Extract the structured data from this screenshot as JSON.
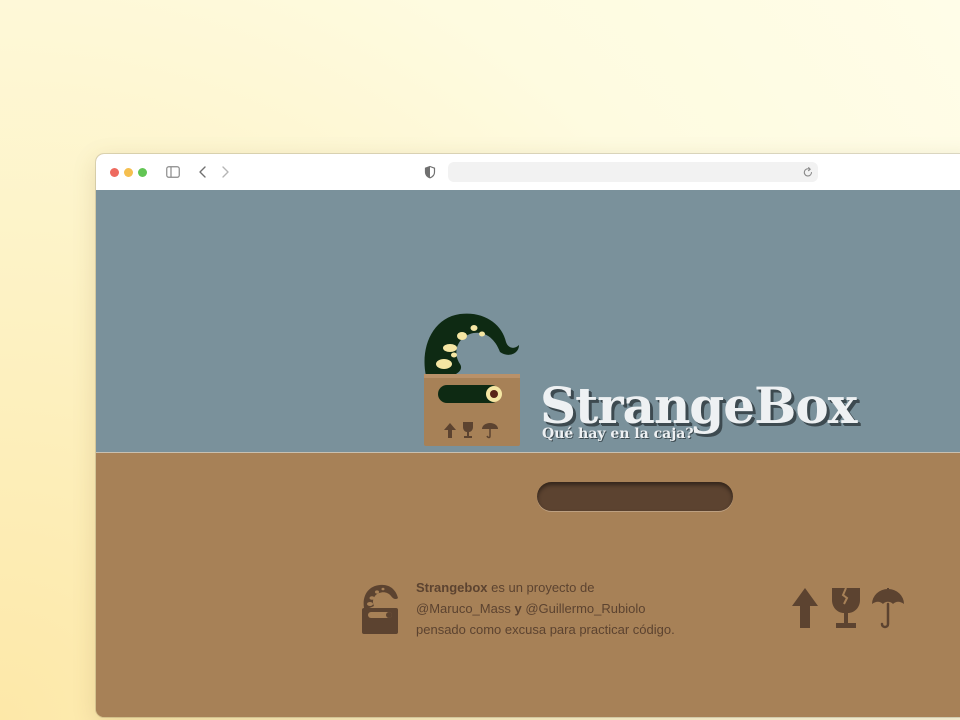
{
  "browser": {
    "url": "",
    "icons": [
      "sidebar-icon",
      "back-icon",
      "forward-icon",
      "shield-icon",
      "reload-icon"
    ]
  },
  "hero": {
    "title": "StrangeBox",
    "subtitle": "Qué hay en la caja?"
  },
  "footer": {
    "line1_strong": "Strangebox",
    "line1_rest": " es un proyecto de",
    "author1": "@Maruco_Mass",
    "connector": " y ",
    "author2": "@Guillermo_Rubiolo",
    "line3": "pensado como excusa para practicar código.",
    "icons": [
      "this-way-up-arrow-icon",
      "fragile-glass-icon",
      "keep-dry-umbrella-icon"
    ]
  },
  "colors": {
    "sky": "#7a919b",
    "ground": "#a78157",
    "dark_brown": "#5c4330",
    "tentacle": "#0e2a13",
    "spots": "#f5e6a3",
    "title": "#eef1f3"
  }
}
